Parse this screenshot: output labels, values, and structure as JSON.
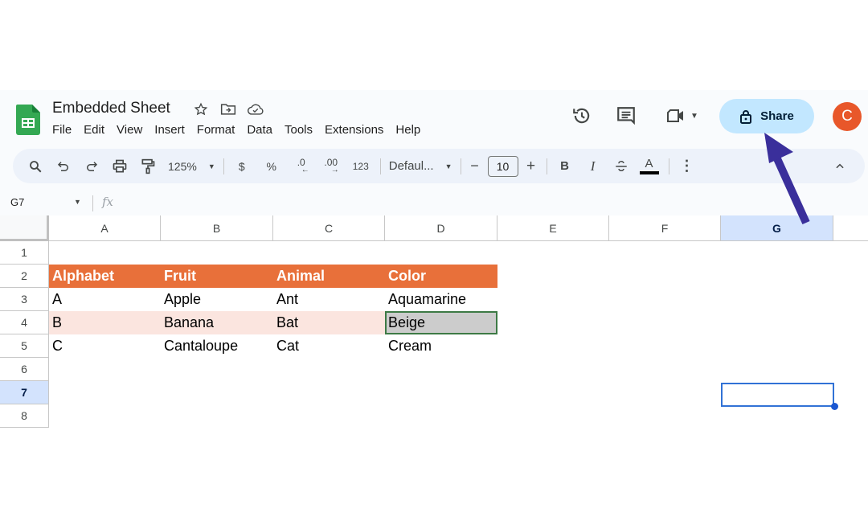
{
  "app": {
    "title": "Embedded Sheet",
    "title_icons": [
      "star-icon",
      "move-to-folder-icon",
      "cloud-saved-icon"
    ],
    "menu": [
      "File",
      "Edit",
      "View",
      "Insert",
      "Format",
      "Data",
      "Tools",
      "Extensions",
      "Help"
    ],
    "right_icons": [
      "version-history-icon",
      "comments-icon",
      "meet-video-icon"
    ],
    "share_label": "Share",
    "avatar_initial": "C",
    "colors": {
      "share_bg": "#c2e7ff",
      "avatar": "#e8572a",
      "accent": "#0b57d0",
      "header_fill": "#e8703a",
      "band_fill": "#fbe5df",
      "arrow": "#3a2f9b"
    }
  },
  "toolbar": {
    "zoom": "125%",
    "currency": "$",
    "percent": "%",
    "decrease_decimal": ".0",
    "increase_decimal": ".00",
    "more_formats": "123",
    "font": "Defaul...",
    "font_size_minus": "−",
    "font_size": "10",
    "font_size_plus": "+",
    "bold": "B",
    "italic": "I",
    "strikethrough": "S",
    "text_color": "A"
  },
  "formula_bar": {
    "name_box": "G7",
    "fx": "fx",
    "value": ""
  },
  "sheet": {
    "columns": [
      "A",
      "B",
      "C",
      "D",
      "E",
      "F",
      "G"
    ],
    "selected_column": "G",
    "rows": [
      "1",
      "2",
      "3",
      "4",
      "5",
      "6",
      "7",
      "8"
    ],
    "selected_row": "7",
    "header_row": [
      "Alphabet",
      "Fruit",
      "Animal",
      "Color"
    ],
    "data_rows": [
      [
        "A",
        "Apple",
        "Ant",
        "Aquamarine"
      ],
      [
        "B",
        "Banana",
        "Bat",
        "Beige"
      ],
      [
        "C",
        "Cantaloupe",
        "Cat",
        "Cream"
      ]
    ],
    "highlighted_cell": "D4",
    "active_cell": "G7"
  }
}
